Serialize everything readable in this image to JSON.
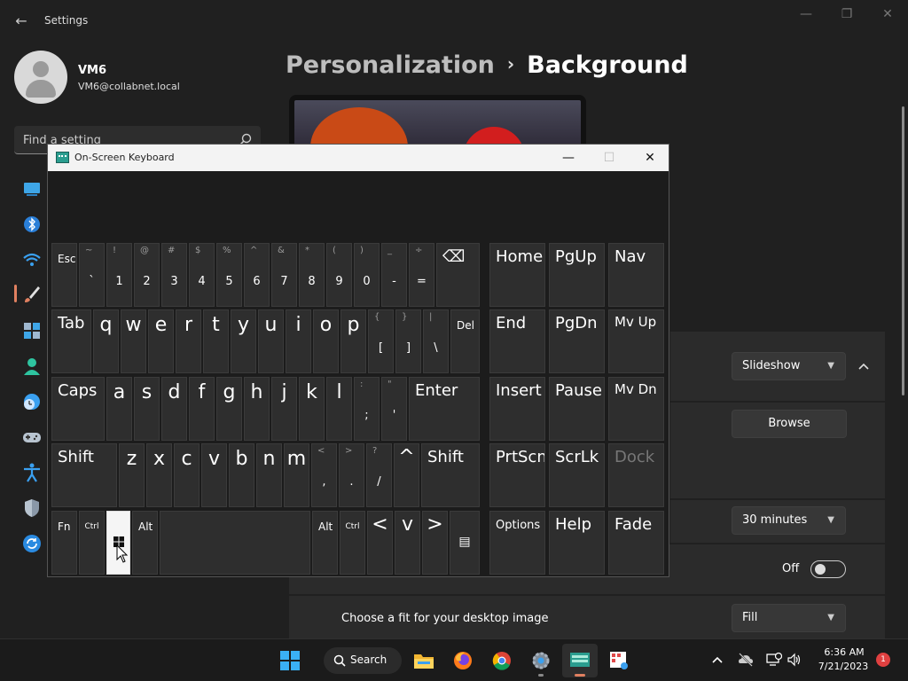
{
  "window": {
    "title": "Settings",
    "back_glyph": "←",
    "minimize_glyph": "—",
    "maximize_glyph": "❐",
    "close_glyph": "✕"
  },
  "user": {
    "name": "VM6",
    "email": "VM6@collabnet.local"
  },
  "search": {
    "placeholder": "Find a setting",
    "icon": "search-icon"
  },
  "nav_icons": [
    "system-icon",
    "bluetooth-icon",
    "network-icon",
    "personalization-brush-icon",
    "apps-icon",
    "accounts-icon",
    "time-language-icon",
    "gaming-icon",
    "accessibility-icon",
    "privacy-shield-icon",
    "windows-update-icon"
  ],
  "breadcrumb": {
    "parent": "Personalization",
    "separator": "›",
    "current": "Background"
  },
  "background": {
    "type_value": "Slideshow",
    "browse_label": "Browse",
    "interval_value": "30 minutes",
    "shuffle_state": "Off",
    "fit_label": "Choose a fit for your desktop image",
    "fit_value": "Fill"
  },
  "osk": {
    "title": "On-Screen Keyboard",
    "minimize_glyph": "—",
    "maximize_glyph": "☐",
    "close_glyph": "✕",
    "row1": [
      {
        "s": "",
        "m": "Esc"
      },
      {
        "s": "~",
        "m": "`"
      },
      {
        "s": "!",
        "m": "1"
      },
      {
        "s": "@",
        "m": "2"
      },
      {
        "s": "#",
        "m": "3"
      },
      {
        "s": "$",
        "m": "4"
      },
      {
        "s": "%",
        "m": "5"
      },
      {
        "s": "^",
        "m": "6"
      },
      {
        "s": "&",
        "m": "7"
      },
      {
        "s": "*",
        "m": "8"
      },
      {
        "s": "(",
        "m": "9"
      },
      {
        "s": ")",
        "m": "0"
      },
      {
        "s": "_",
        "m": "-"
      },
      {
        "s": "÷",
        "m": "="
      }
    ],
    "backspace_glyph": "⌫",
    "row2_tab": "Tab",
    "row2_letters": [
      "q",
      "w",
      "e",
      "r",
      "t",
      "y",
      "u",
      "i",
      "o",
      "p"
    ],
    "row2_sym": [
      {
        "s": "{",
        "m": "["
      },
      {
        "s": "}",
        "m": "]"
      },
      {
        "s": "|",
        "m": "\\"
      }
    ],
    "row2_del": "Del",
    "row3_caps": "Caps",
    "row3_letters": [
      "a",
      "s",
      "d",
      "f",
      "g",
      "h",
      "j",
      "k",
      "l"
    ],
    "row3_sym": [
      {
        "s": ":",
        "m": ";"
      },
      {
        "s": "\"",
        "m": "'"
      }
    ],
    "row3_enter": "Enter",
    "row4_shift": "Shift",
    "row4_letters": [
      "z",
      "x",
      "c",
      "v",
      "b",
      "n",
      "m"
    ],
    "row4_sym": [
      {
        "s": "<",
        "m": ","
      },
      {
        "s": ">",
        "m": "."
      },
      {
        "s": "?",
        "m": "/"
      }
    ],
    "row4_up": "^",
    "row5": {
      "fn": "Fn",
      "ctrl": "Ctrl",
      "alt": "Alt",
      "left": "<",
      "down": "v",
      "right": ">",
      "menu_glyph": "▤"
    },
    "nav_keys": [
      [
        "Home",
        "PgUp",
        "Nav"
      ],
      [
        "End",
        "PgDn",
        "Mv Up"
      ],
      [
        "Insert",
        "Pause",
        "Mv Dn"
      ],
      [
        "PrtScn",
        "ScrLk",
        "Dock"
      ],
      [
        "Options",
        "Help",
        "Fade"
      ]
    ]
  },
  "taskbar": {
    "search_label": "Search",
    "apps": [
      "windows-start-icon",
      "file-explorer-icon",
      "firefox-icon",
      "chrome-icon",
      "settings-gear-icon",
      "on-screen-keyboard-icon",
      "snipping-tool-icon"
    ],
    "time": "6:36 AM",
    "date": "7/21/2023",
    "notification_count": "1"
  },
  "colors": {
    "accent": "#e08060",
    "panel": "#2b2b2b",
    "background": "#202020",
    "taskbar": "#1b1b1b"
  }
}
